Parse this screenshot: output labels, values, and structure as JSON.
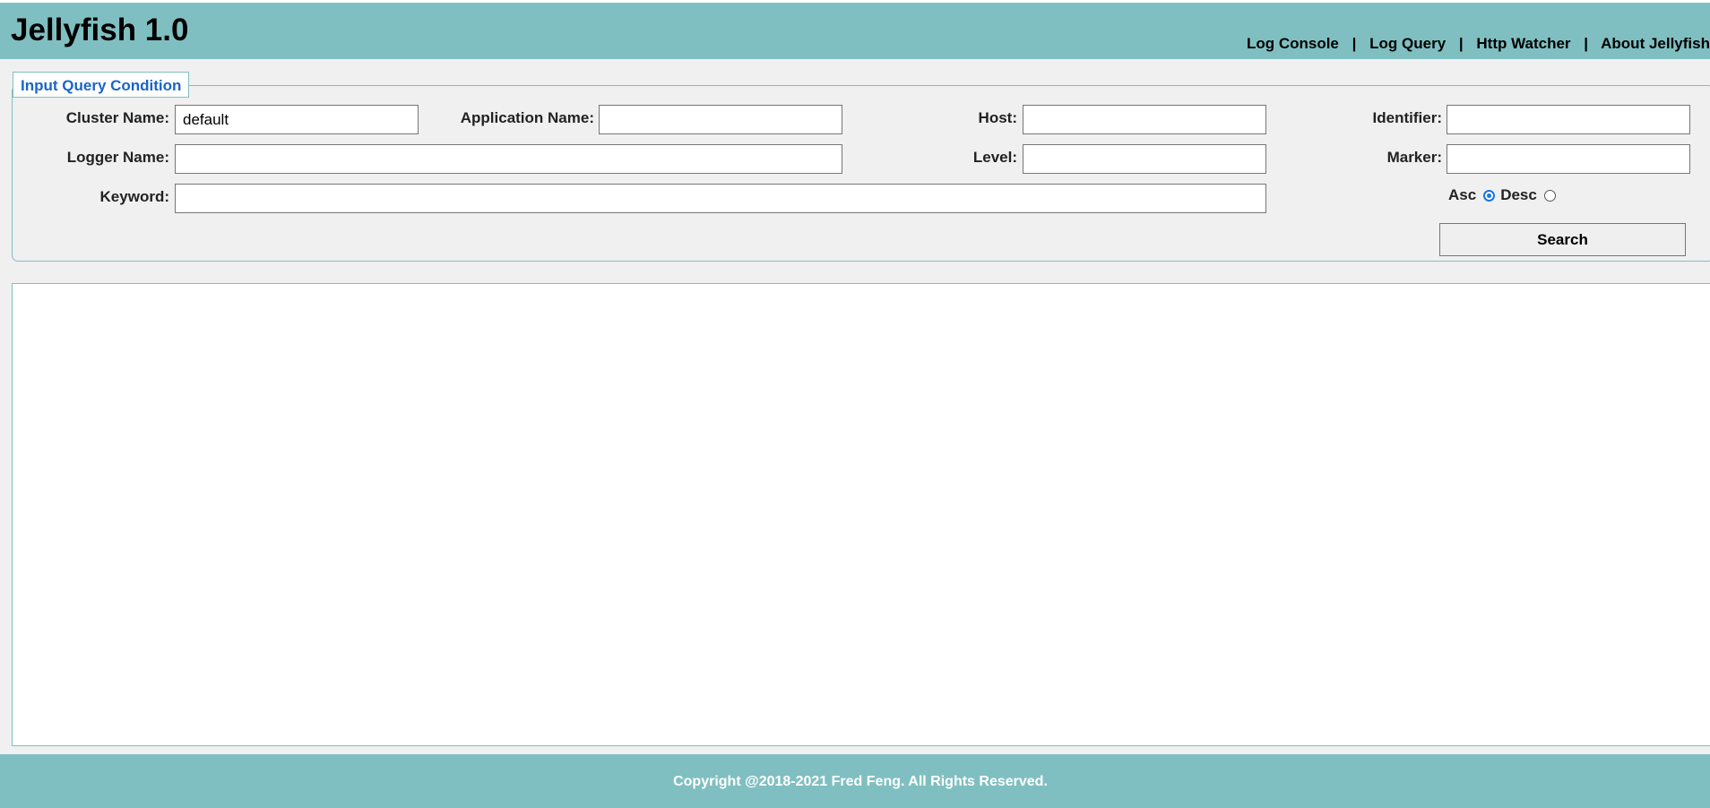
{
  "header": {
    "title": "Jellyfish 1.0",
    "nav": [
      {
        "label": "Log Console"
      },
      {
        "label": "Log Query"
      },
      {
        "label": "Http Watcher"
      },
      {
        "label": "About Jellyfish"
      }
    ],
    "separator": "|"
  },
  "query": {
    "legend": "Input Query Condition",
    "cluster_name": {
      "label": "Cluster Name:",
      "value": "default"
    },
    "application_name": {
      "label": "Application Name:",
      "value": ""
    },
    "host": {
      "label": "Host:",
      "value": ""
    },
    "identifier": {
      "label": "Identifier:",
      "value": ""
    },
    "logger_name": {
      "label": "Logger Name:",
      "value": ""
    },
    "level": {
      "label": "Level:",
      "value": ""
    },
    "marker": {
      "label": "Marker:",
      "value": ""
    },
    "keyword": {
      "label": "Keyword:",
      "value": ""
    },
    "order": {
      "asc_label": "Asc",
      "desc_label": "Desc",
      "selected": "asc"
    },
    "search_label": "Search"
  },
  "footer": {
    "copyright": "Copyright @2018-2021 Fred Feng. All Rights Reserved."
  },
  "colors": {
    "header_bg": "#80bfc1",
    "legend_text": "#1a64c8",
    "radio_checked": "#1a73e8"
  }
}
